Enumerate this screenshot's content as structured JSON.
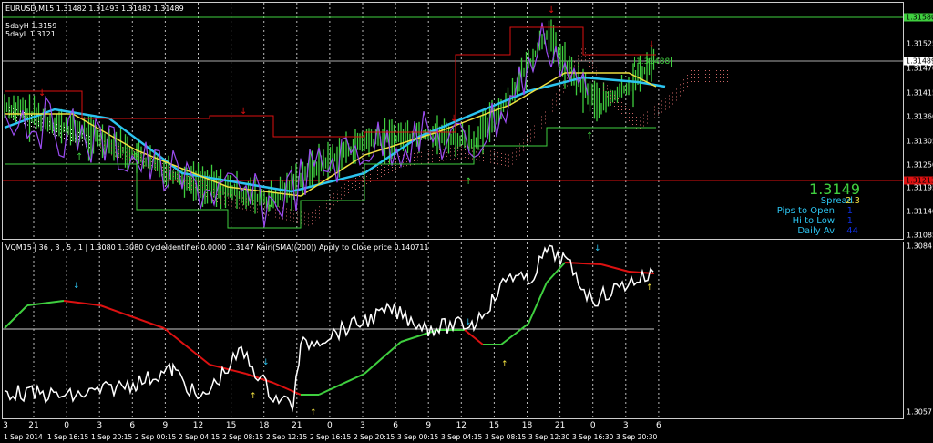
{
  "main": {
    "title": "EURUSD,M15  1.31482 1.31493 1.31482 1.31489",
    "five_day_high": "5dayH 1.3159",
    "five_day_low": "5dayL 1.3121",
    "bid_box": "1.31488",
    "price_axis": [
      [
        "1.31525",
        48
      ],
      [
        "1.31470",
        75
      ],
      [
        "1.31415",
        102
      ],
      [
        "1.31360",
        128
      ],
      [
        "1.31305",
        155
      ],
      [
        "1.31250",
        181
      ],
      [
        "1.31195",
        206
      ],
      [
        "1.31140",
        232
      ],
      [
        "1.31085",
        258
      ]
    ],
    "highlights": {
      "green": "1.31580",
      "white": "1.31489",
      "red": "1.31213"
    },
    "info": {
      "price": "1.3149",
      "spread_label": "Spread",
      "spread": "2.3",
      "pips_label": "Pips to Open",
      "pips": "1",
      "hilo_label": "Hi to Low",
      "hilo": "1",
      "daily_label": "Daily Av",
      "daily": "44"
    }
  },
  "sub": {
    "title": "VQM15 | 36 , 3 , 5 , 1  |  1.3080 1.3080  CycleIdentifier 0.0000 1.3147  Kairi(SMA((200)) Apply to Close price 0.140711",
    "axis_top": "1.3084",
    "axis_bottom": "1.3057"
  },
  "time_axis": {
    "hours": [
      "3",
      "21",
      "0",
      "3",
      "6",
      "9",
      "12",
      "15",
      "18",
      "21",
      "0",
      "3",
      "6",
      "9",
      "12",
      "15",
      "18",
      "21",
      "0",
      "3",
      "6"
    ],
    "dates": [
      "1 Sep 2014",
      "1 Sep 16:15",
      "1 Sep 20:15",
      "2 Sep 00:15",
      "2 Sep 04:15",
      "2 Sep 08:15",
      "2 Sep 12:15",
      "2 Sep 16:15",
      "2 Sep 20:15",
      "3 Sep 00:15",
      "3 Sep 04:15",
      "3 Sep 08:15",
      "3 Sep 12:30",
      "3 Sep 16:30",
      "3 Sep 20:30"
    ]
  },
  "colors": {
    "green": "#3fcf3f",
    "red": "#d11",
    "cyan": "#2cc4f0",
    "yellow": "#f0e040",
    "purple": "#9a4cf0",
    "blue": "#1030e0"
  }
}
